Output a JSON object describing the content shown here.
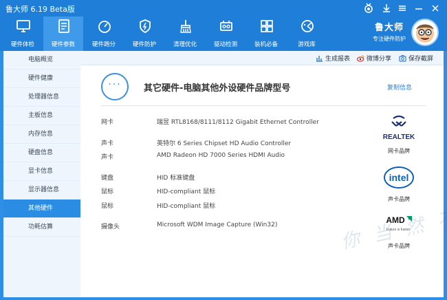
{
  "window": {
    "title": "鲁大师 6.19 Beta版"
  },
  "toolbar": {
    "items": [
      {
        "label": "硬件体检",
        "icon": "monitor-icon"
      },
      {
        "label": "硬件参数",
        "icon": "document-icon"
      },
      {
        "label": "硬件跑分",
        "icon": "speedometer-icon"
      },
      {
        "label": "硬件防护",
        "icon": "shield-lightning-icon"
      },
      {
        "label": "清理优化",
        "icon": "broom-icon"
      },
      {
        "label": "驱动检测",
        "icon": "driver-chip-icon"
      },
      {
        "label": "装机必备",
        "icon": "grid-apps-icon"
      },
      {
        "label": "游戏库",
        "icon": "gamepad-icon"
      }
    ],
    "active_index": 1
  },
  "brand": {
    "name": "鲁大师",
    "slogan": "专注硬件防护"
  },
  "sidebar": {
    "items": [
      {
        "label": "电脑概览"
      },
      {
        "label": "硬件健康"
      },
      {
        "label": "处理器信息"
      },
      {
        "label": "主板信息"
      },
      {
        "label": "内存信息"
      },
      {
        "label": "硬盘信息"
      },
      {
        "label": "显卡信息"
      },
      {
        "label": "显示器信息"
      },
      {
        "label": "其他硬件"
      },
      {
        "label": "功耗估算"
      }
    ],
    "active_index": 8
  },
  "actions": {
    "report": "生成报表",
    "share": "微博分享",
    "screenshot": "保存截屏"
  },
  "header": {
    "icon_text": "···",
    "title": "其它硬件-电脑其他外设硬件品牌型号",
    "copy_label": "复制信息"
  },
  "hardware": [
    {
      "label": "网卡",
      "value": "瑞昱 RTL8168/8111/8112 Gigabit Ethernet Controller"
    },
    {
      "label": "声卡",
      "value": "英特尔 6 Series Chipset HD Audio Controller"
    },
    {
      "label": "声卡",
      "value": "AMD Radeon HD 7000 Series HDMI Audio"
    },
    {
      "label": "键盘",
      "value": "HID 标准键盘"
    },
    {
      "label": "鼠标",
      "value": "HID-compliant 鼠标"
    },
    {
      "label": "鼠标",
      "value": "HID-compliant 鼠标"
    },
    {
      "label": "摄像头",
      "value": "Microsoft WDM Image Capture (Win32)"
    }
  ],
  "brand_logos": [
    {
      "text": "REALTEK",
      "caption": "网卡品牌",
      "color": "#1a2f6e"
    },
    {
      "text": "intel",
      "caption": "声卡品牌",
      "color": "#0d5fb8"
    },
    {
      "text": "AMD",
      "caption": "声卡品牌",
      "color": "#111111"
    }
  ],
  "logo_subtexts": {
    "amd": "Future is fusion"
  },
  "watermark": "你 当 然 不",
  "colors": {
    "titlebar": "#1f7fd8",
    "accent": "#2b8ce3",
    "sidebar_bg": "#eef5fc"
  }
}
